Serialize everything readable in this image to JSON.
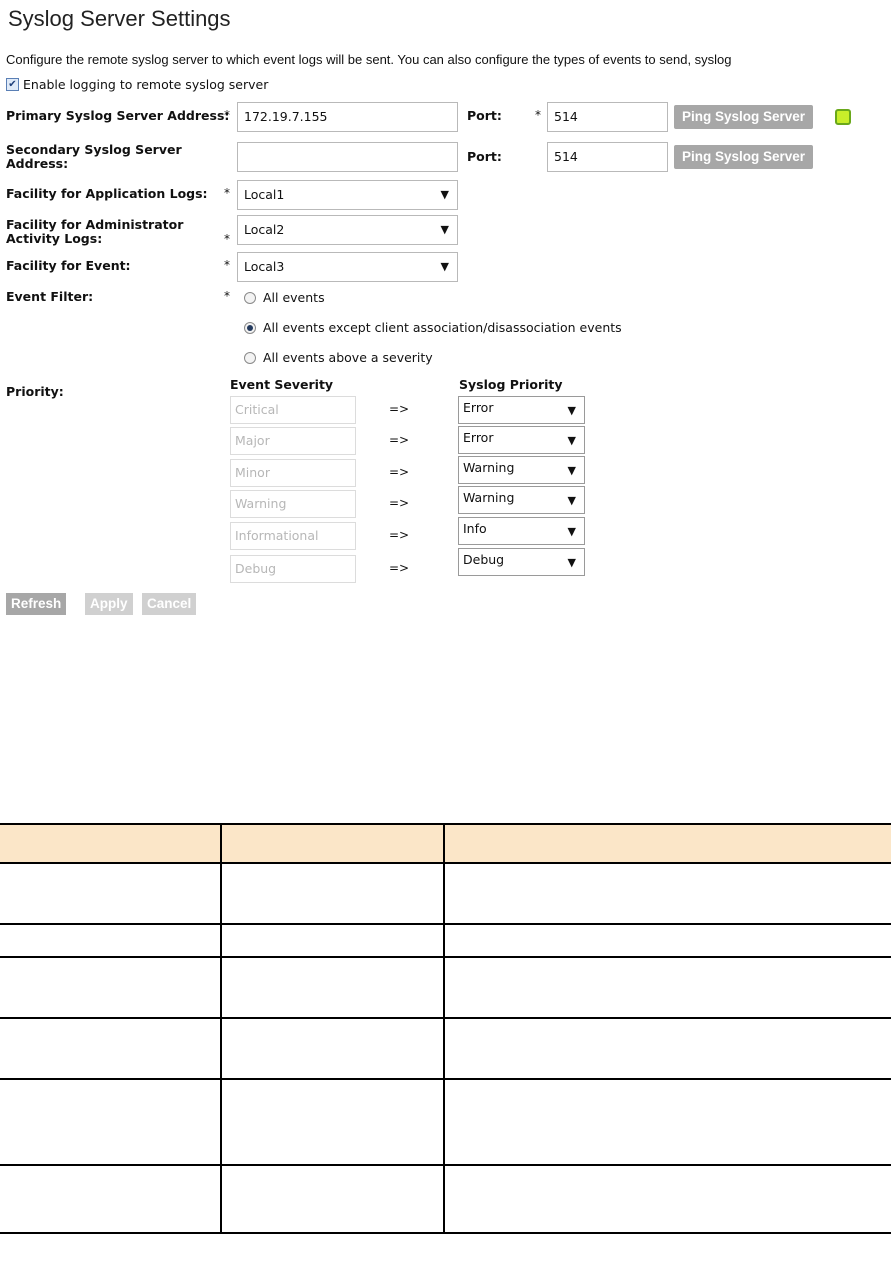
{
  "page": {
    "title": "Syslog Server Settings",
    "description": "Configure the remote syslog server to which event logs will be sent. You can also configure the types of events to send, syslog",
    "enable_logging_label": "Enable logging to remote syslog server",
    "enable_logging_checked": true
  },
  "form": {
    "primary_label": "Primary Syslog Server Address:",
    "primary_value": "172.19.7.155",
    "primary_port_label": "Port:",
    "primary_port_value": "514",
    "secondary_label_line1": "Secondary Syslog Server",
    "secondary_label_line2": "Address:",
    "secondary_value": "",
    "secondary_port_label": "Port:",
    "secondary_port_value": "514",
    "ping_button": "Ping Syslog Server",
    "required_mark": "*",
    "app_facility_label": "Facility for Application Logs:",
    "app_facility_value": "Local1",
    "admin_facility_label_line1": "Facility for Administrator",
    "admin_facility_label_line2": "Activity Logs:",
    "admin_facility_value": "Local2",
    "event_facility_label": "Facility for Event:",
    "event_facility_value": "Local3",
    "event_filter_label": "Event Filter:",
    "event_filter_options": [
      "All events",
      "All events except client association/disassociation events",
      "All events above a severity"
    ],
    "event_filter_selected_index": 1,
    "priority_label": "Priority:",
    "severity_header": "Event Severity",
    "syslog_priority_header": "Syslog Priority",
    "arrow_text": "=>",
    "severity_map": [
      {
        "severity": "Critical",
        "priority": "Error"
      },
      {
        "severity": "Major",
        "priority": "Error"
      },
      {
        "severity": "Minor",
        "priority": "Warning"
      },
      {
        "severity": "Warning",
        "priority": "Warning"
      },
      {
        "severity": "Informational",
        "priority": "Info"
      },
      {
        "severity": "Debug",
        "priority": "Debug"
      }
    ]
  },
  "actions": {
    "refresh": "Refresh",
    "apply": "Apply",
    "cancel": "Cancel"
  },
  "colors": {
    "button_gray": "#a7a7a7",
    "button_disabled": "#d0d0d0",
    "status_led": "#c8ee2a",
    "table_header_bg": "#fbe6c8"
  },
  "icons": {
    "dropdown": "▼",
    "checkmark": "✔"
  }
}
